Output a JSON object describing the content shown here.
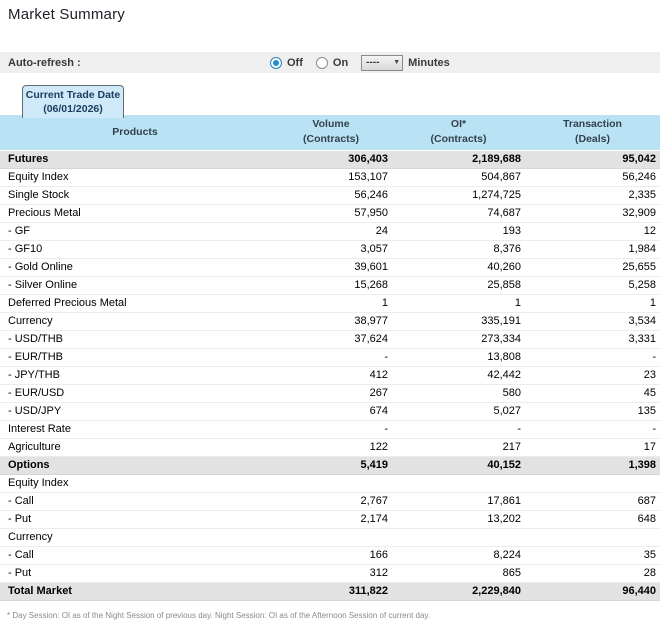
{
  "page": {
    "title": "Market Summary"
  },
  "auto_refresh": {
    "label": "Auto-refresh :",
    "off_label": "Off",
    "on_label": "On",
    "selected": "Off",
    "interval_value": "----",
    "minutes_label": "Minutes"
  },
  "tab": {
    "line1": "Current Trade Date",
    "line2": "(06/01/2026)"
  },
  "table": {
    "headers": [
      {
        "line1": "Products",
        "line2": ""
      },
      {
        "line1": "Volume",
        "line2": "(Contracts)"
      },
      {
        "line1": "OI*",
        "line2": "(Contracts)"
      },
      {
        "line1": "Transaction",
        "line2": "(Deals)"
      }
    ],
    "rows": [
      {
        "product": "Futures",
        "volume": "306,403",
        "oi": "2,189,688",
        "transaction": "95,042",
        "style": "section"
      },
      {
        "product": "Equity Index",
        "volume": "153,107",
        "oi": "504,867",
        "transaction": "56,246",
        "style": "normal"
      },
      {
        "product": "Single Stock",
        "volume": "56,246",
        "oi": "1,274,725",
        "transaction": "2,335",
        "style": "normal"
      },
      {
        "product": "Precious Metal",
        "volume": "57,950",
        "oi": "74,687",
        "transaction": "32,909",
        "style": "normal"
      },
      {
        "product": "- GF",
        "volume": "24",
        "oi": "193",
        "transaction": "12",
        "style": "normal"
      },
      {
        "product": "- GF10",
        "volume": "3,057",
        "oi": "8,376",
        "transaction": "1,984",
        "style": "normal"
      },
      {
        "product": "- Gold Online",
        "volume": "39,601",
        "oi": "40,260",
        "transaction": "25,655",
        "style": "normal"
      },
      {
        "product": "- Silver Online",
        "volume": "15,268",
        "oi": "25,858",
        "transaction": "5,258",
        "style": "normal"
      },
      {
        "product": "Deferred Precious Metal",
        "volume": "1",
        "oi": "1",
        "transaction": "1",
        "style": "normal"
      },
      {
        "product": "Currency",
        "volume": "38,977",
        "oi": "335,191",
        "transaction": "3,534",
        "style": "normal"
      },
      {
        "product": "- USD/THB",
        "volume": "37,624",
        "oi": "273,334",
        "transaction": "3,331",
        "style": "normal"
      },
      {
        "product": "- EUR/THB",
        "volume": "-",
        "oi": "13,808",
        "transaction": "-",
        "style": "normal"
      },
      {
        "product": "- JPY/THB",
        "volume": "412",
        "oi": "42,442",
        "transaction": "23",
        "style": "normal"
      },
      {
        "product": "- EUR/USD",
        "volume": "267",
        "oi": "580",
        "transaction": "45",
        "style": "normal"
      },
      {
        "product": "- USD/JPY",
        "volume": "674",
        "oi": "5,027",
        "transaction": "135",
        "style": "normal"
      },
      {
        "product": "Interest Rate",
        "volume": "-",
        "oi": "-",
        "transaction": "-",
        "style": "normal"
      },
      {
        "product": "Agriculture",
        "volume": "122",
        "oi": "217",
        "transaction": "17",
        "style": "normal"
      },
      {
        "product": "Options",
        "volume": "5,419",
        "oi": "40,152",
        "transaction": "1,398",
        "style": "section"
      },
      {
        "product": "Equity Index",
        "volume": "",
        "oi": "",
        "transaction": "",
        "style": "normal"
      },
      {
        "product": "- Call",
        "volume": "2,767",
        "oi": "17,861",
        "transaction": "687",
        "style": "normal"
      },
      {
        "product": "- Put",
        "volume": "2,174",
        "oi": "13,202",
        "transaction": "648",
        "style": "normal"
      },
      {
        "product": "Currency",
        "volume": "",
        "oi": "",
        "transaction": "",
        "style": "normal"
      },
      {
        "product": "- Call",
        "volume": "166",
        "oi": "8,224",
        "transaction": "35",
        "style": "normal"
      },
      {
        "product": "- Put",
        "volume": "312",
        "oi": "865",
        "transaction": "28",
        "style": "normal"
      },
      {
        "product": "Total Market",
        "volume": "311,822",
        "oi": "2,229,840",
        "transaction": "96,440",
        "style": "section"
      }
    ]
  },
  "footnote": "* Day Session: OI as of the Night Session of previous day. Night Session: OI as of the Afternoon Session of current day.",
  "colors": {
    "header_blue": "#b9e3f5",
    "tab_fill": "#cfe9f8",
    "tab_text": "#1c3e60",
    "section_row_gray": "#e2e2e2",
    "refresh_bar_gray": "#efefef",
    "radio_selected_blue": "#1e8fd5"
  }
}
